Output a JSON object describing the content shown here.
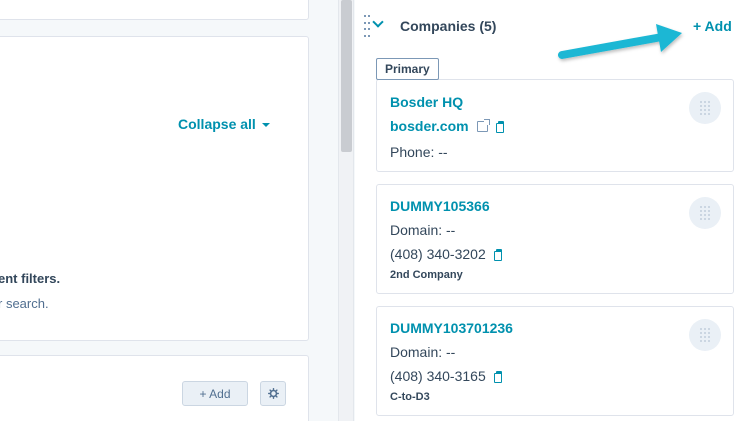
{
  "left": {
    "collapse_all": "Collapse all",
    "empty_title": "ent filters.",
    "empty_sub": "r search.",
    "add_button": "+ Add"
  },
  "companies": {
    "title": "Companies (5)",
    "add": "+ Add",
    "primary_tag": "Primary",
    "cards": [
      {
        "name": "Bosder HQ",
        "domain": "bosder.com",
        "phone": "Phone: --"
      },
      {
        "name": "DUMMY105366",
        "domain": "Domain: --",
        "phone": "(408) 340-3202",
        "association": "2nd Company"
      },
      {
        "name": "DUMMY103701236",
        "domain": "Domain: --",
        "phone": "(408) 340-3165",
        "association": "C-to-D3"
      }
    ]
  },
  "colors": {
    "accent": "#0091ae",
    "text": "#33475b",
    "annotation_arrow": "#1ab7d4"
  },
  "icons": [
    "drag-handle-icon",
    "chevron-down-icon",
    "external-link-icon",
    "copy-icon",
    "building-icon",
    "gear-icon",
    "arrow-annotation"
  ]
}
